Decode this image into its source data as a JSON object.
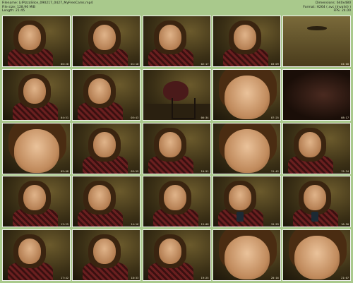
{
  "header": {
    "filename_label": "Filename:",
    "filename": "LilPizzaSlice_090217_0427_MyFreeCams.mp4",
    "filesize_label": "File size:",
    "filesize": "128.96 MiB",
    "length_label": "Length:",
    "length": "21:45",
    "dimensions_label": "Dimensions:",
    "dimensions": "640x480",
    "format_label": "Format:",
    "format": "H264 ( avc (Invalid) )",
    "fps_label": "FPS:",
    "fps": "24.00"
  },
  "colors": {
    "header_bg": "#a9c98c",
    "frame_border": "#f4f4f4"
  },
  "thumbnails": [
    {
      "time": "00:28",
      "scene": "face"
    },
    {
      "time": "01:18",
      "scene": "face"
    },
    {
      "time": "02:17",
      "scene": "face"
    },
    {
      "time": "03:09",
      "scene": "face"
    },
    {
      "time": "04:00",
      "scene": "empty"
    },
    {
      "time": "04:51",
      "scene": "face"
    },
    {
      "time": "05:43",
      "scene": "face"
    },
    {
      "time": "06:34",
      "scene": "chair"
    },
    {
      "time": "07:25",
      "scene": "close"
    },
    {
      "time": "08:17",
      "scene": "dark"
    },
    {
      "time": "09:08",
      "scene": "close"
    },
    {
      "time": "09:59",
      "scene": "face"
    },
    {
      "time": "10:51",
      "scene": "face"
    },
    {
      "time": "11:42",
      "scene": "close"
    },
    {
      "time": "12:34",
      "scene": "face"
    },
    {
      "time": "13:25",
      "scene": "face"
    },
    {
      "time": "14:16",
      "scene": "face"
    },
    {
      "time": "15:08",
      "scene": "face"
    },
    {
      "time": "15:59",
      "scene": "phone"
    },
    {
      "time": "16:50",
      "scene": "phone"
    },
    {
      "time": "17:42",
      "scene": "face"
    },
    {
      "time": "18:33",
      "scene": "face"
    },
    {
      "time": "19:25",
      "scene": "face"
    },
    {
      "time": "20:16",
      "scene": "close"
    },
    {
      "time": "21:07",
      "scene": "close"
    }
  ]
}
